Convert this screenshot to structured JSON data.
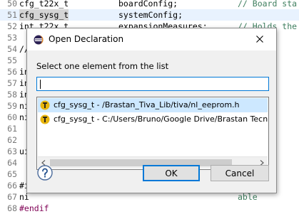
{
  "editor": {
    "lines": [
      {
        "num": "50",
        "c1": "cfg_t22x_t",
        "c2": "boardConfig;",
        "c3": "// Board sta"
      },
      {
        "num": "51",
        "c1": "cfg_sysg_t",
        "c2": "systemConfig;",
        "c3": "",
        "highlight": true
      },
      {
        "num": "52",
        "c1": "int t22x_t",
        "c2": "expansionMeasures;",
        "c3": "// Holds the"
      },
      {
        "num": "53",
        "c1": "",
        "c2": "",
        "c3": ""
      },
      {
        "num": "54",
        "c1": "//",
        "c2": "",
        "c3": "inter"
      },
      {
        "num": "55",
        "c1": "",
        "c2": "",
        "c3": ""
      },
      {
        "num": "56",
        "c1": "in",
        "c2": "",
        "c3": ""
      },
      {
        "num": "57",
        "c1": "in",
        "c2": "",
        "c3": ""
      },
      {
        "num": "58",
        "c1": "in",
        "c2": "",
        "c3": ""
      },
      {
        "num": "59",
        "c1": "ni",
        "c2": "",
        "c3": "t tha"
      },
      {
        "num": "60",
        "c1": "ni",
        "c2": "",
        "c3": "t tha"
      },
      {
        "num": "61",
        "c1": "",
        "c2": "",
        "c3": ""
      },
      {
        "num": "62",
        "c1": "",
        "c2": "",
        "c3": ""
      },
      {
        "num": "63",
        "c1": "ui",
        "c2": "",
        "c3": "l end"
      },
      {
        "num": "64",
        "c1": "",
        "c2": "",
        "c3": ""
      },
      {
        "num": "65",
        "c1": "",
        "c2": "",
        "c3": ""
      },
      {
        "num": "66",
        "c1": "#i",
        "c2": "",
        "c3": ""
      },
      {
        "num": "67",
        "c1": "ni",
        "c2": "",
        "c3": "able"
      },
      {
        "num": "68",
        "c1": "#endif",
        "c2": "",
        "c3": ""
      }
    ]
  },
  "dialog": {
    "title": "Open Declaration",
    "prompt": "Select one element from the list",
    "filter_value": "",
    "items": [
      {
        "label": "cfg_sysg_t - /Brastan_Tiva_Lib/tiva/nl_eeprom.h",
        "selected": true,
        "icon": "typedef-icon"
      },
      {
        "label": "cfg_sysg_t - C:/Users/Bruno/Google Drive/Brastan Tecnol",
        "selected": false,
        "icon": "typedef-icon"
      }
    ],
    "ok_label": "OK",
    "cancel_label": "Cancel"
  },
  "colors": {
    "accent": "#0078d7",
    "selection": "#cde8ff",
    "typedef_icon": "#e8b50e"
  }
}
